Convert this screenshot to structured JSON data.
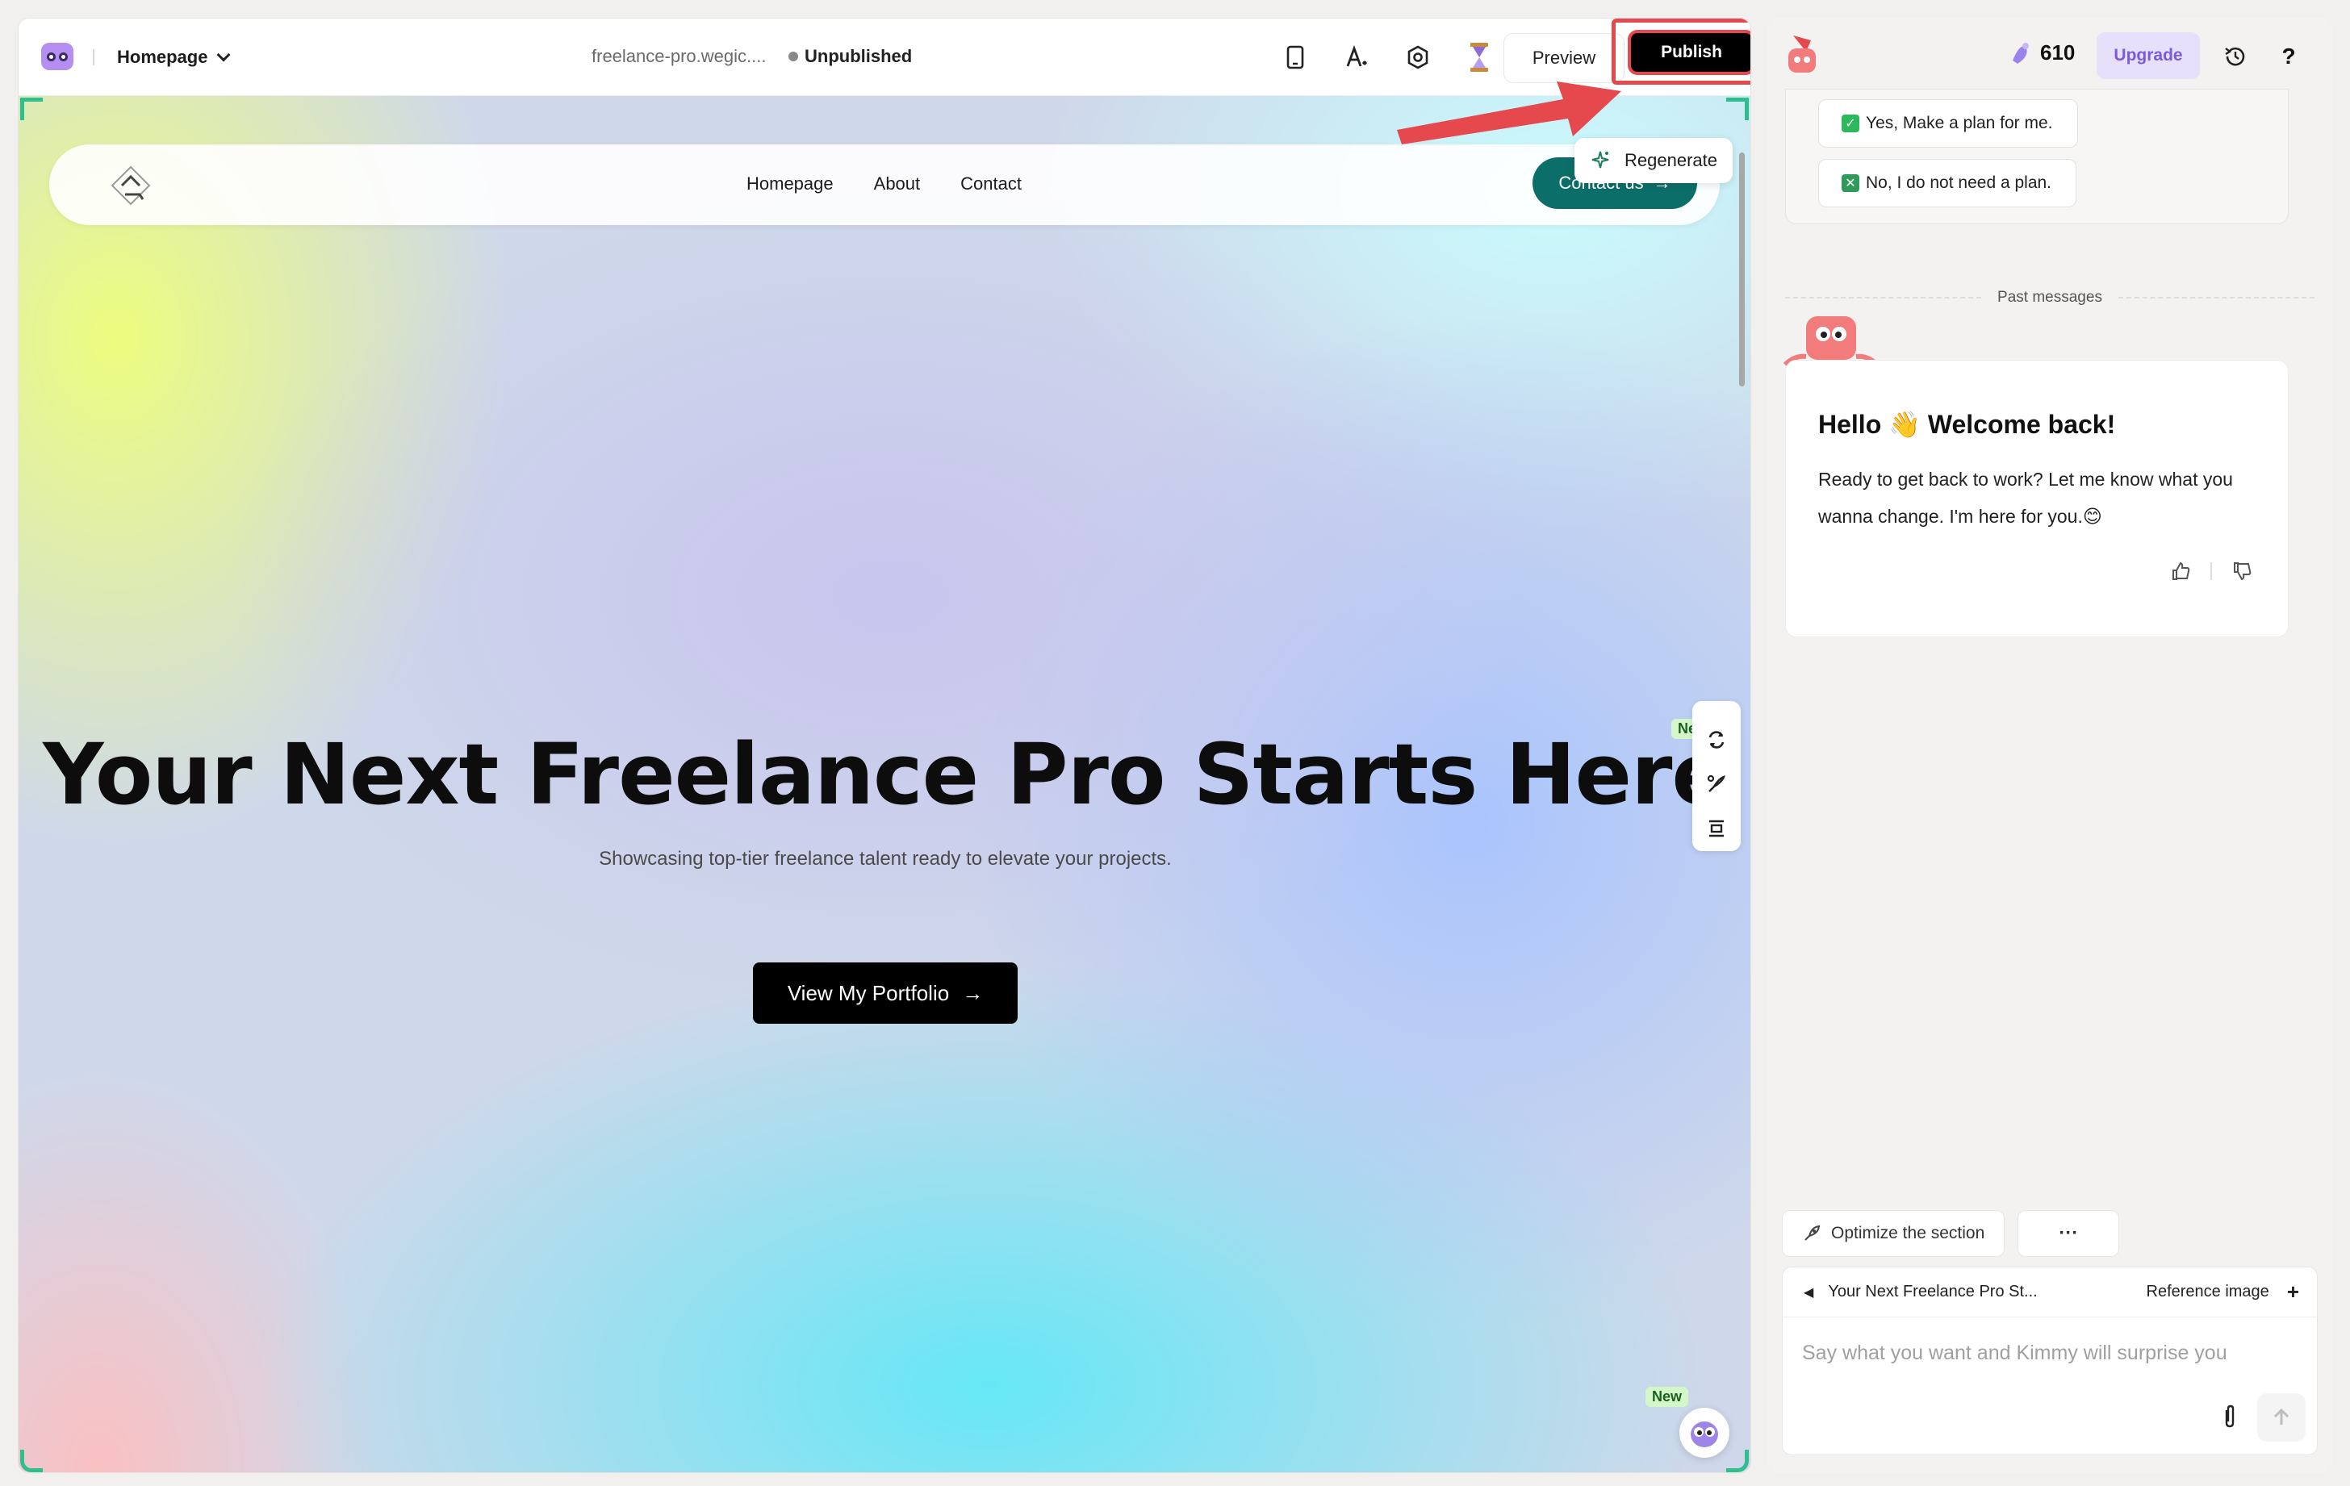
{
  "editor": {
    "page_select": "Homepage",
    "domain": "freelance-pro.wegic....",
    "status": "Unpublished",
    "preview_label": "Preview",
    "publish_label": "Publish",
    "toolbar_icons": [
      "mobile-preview-icon",
      "text-style-icon",
      "settings-icon",
      "hourglass-icon"
    ]
  },
  "site": {
    "nav": [
      "Homepage",
      "About",
      "Contact"
    ],
    "contact_button": "Contact us",
    "regenerate_label": "Regenerate",
    "hero_title": "Your Next Freelance Pro Starts Here",
    "hero_subtitle": "Showcasing top-tier freelance talent ready to elevate your projects.",
    "portfolio_button": "View My Portfolio",
    "new_badge": "New"
  },
  "panel": {
    "credits": "610",
    "upgrade_label": "Upgrade",
    "plan_options": [
      "Yes, Make a plan for me.",
      "No, I do not need a plan."
    ],
    "past_messages_label": "Past messages",
    "welcome_title": "Hello 👋 Welcome back!",
    "welcome_text": "Ready to get back to work? Let me know what you wanna change. I'm here for you.😊",
    "suggest_chip": "Optimize the section",
    "more_label": "···",
    "context_label": "Your Next Freelance Pro St...",
    "reference_label": "Reference image",
    "input_placeholder": "Say what you want and Kimmy will surprise you"
  },
  "colors": {
    "accent_teal": "#0b6e69",
    "highlight_red": "#e5484d",
    "upgrade_purple": "#7c5ad8"
  }
}
